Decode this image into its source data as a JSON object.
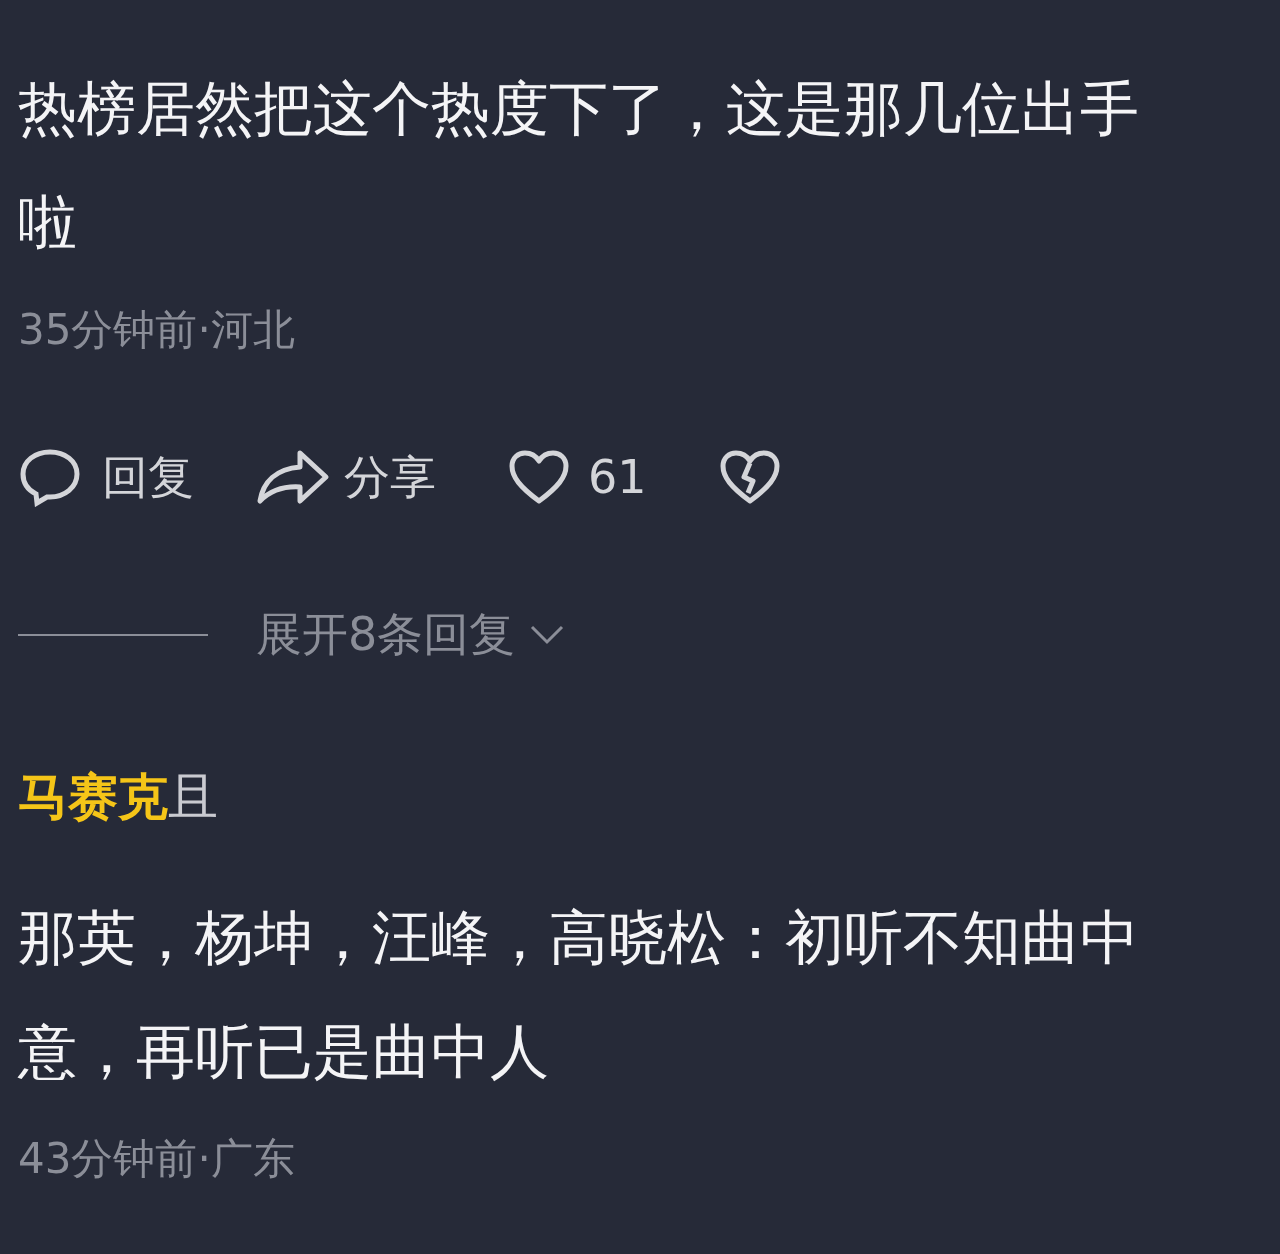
{
  "comments": [
    {
      "text": "热榜居然把这个热度下了，这是那几位出手啦",
      "meta": "35分钟前·河北",
      "actions": {
        "reply": "回复",
        "share": "分享",
        "likes": "61"
      },
      "expand": "展开8条回复"
    },
    {
      "author": {
        "sticker": "马赛克",
        "visible": "且"
      },
      "text": "那英，杨坤，汪峰，高晓松：初听不知曲中意，再听已是曲中人",
      "meta": "43分钟前·广东"
    }
  ]
}
